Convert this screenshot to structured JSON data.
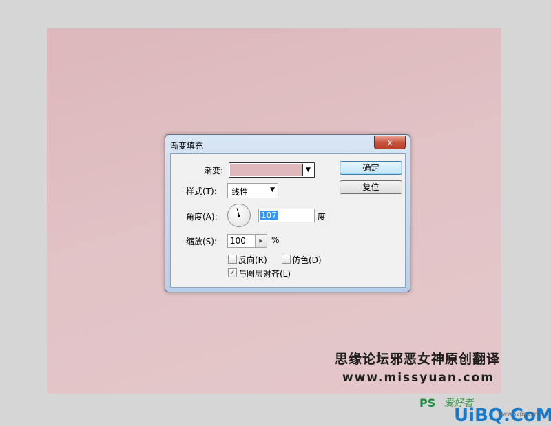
{
  "dialog": {
    "title": "渐变填充",
    "close_glyph": "x",
    "gradient_label": "渐变:",
    "style_label": "样式(T):",
    "style_value": "线性",
    "angle_label": "角度(A):",
    "angle_value": "107",
    "angle_unit": "度",
    "scale_label": "缩放(S):",
    "scale_value": "100",
    "scale_unit": "%",
    "reverse_label": "反向(R)",
    "reverse_checked": false,
    "dither_label": "仿色(D)",
    "dither_checked": false,
    "align_label": "与图层对齐(L)",
    "align_checked": true,
    "check_glyph": "✓",
    "ok_label": "确定",
    "reset_label": "复位"
  },
  "watermark": {
    "line1": "思缘论坛邪恶女神原创翻译",
    "line2": "www.missyuan.com"
  },
  "logo": {
    "ps": "PS",
    "ps_tail": "爱好者",
    "brand": "UiBQ.CoM",
    "small": "www.52ps.com"
  },
  "colors": {
    "gradient_swatch": "#ddb7ba",
    "canvas_top": "#dcb7bb",
    "canvas_bottom": "#e4c7ca",
    "selection": "#3399ff"
  },
  "icons": {
    "close": "close-icon",
    "dropdown": "triangle-down-icon",
    "stepper": "triangle-right-icon",
    "checkmark": "checkmark-icon"
  }
}
